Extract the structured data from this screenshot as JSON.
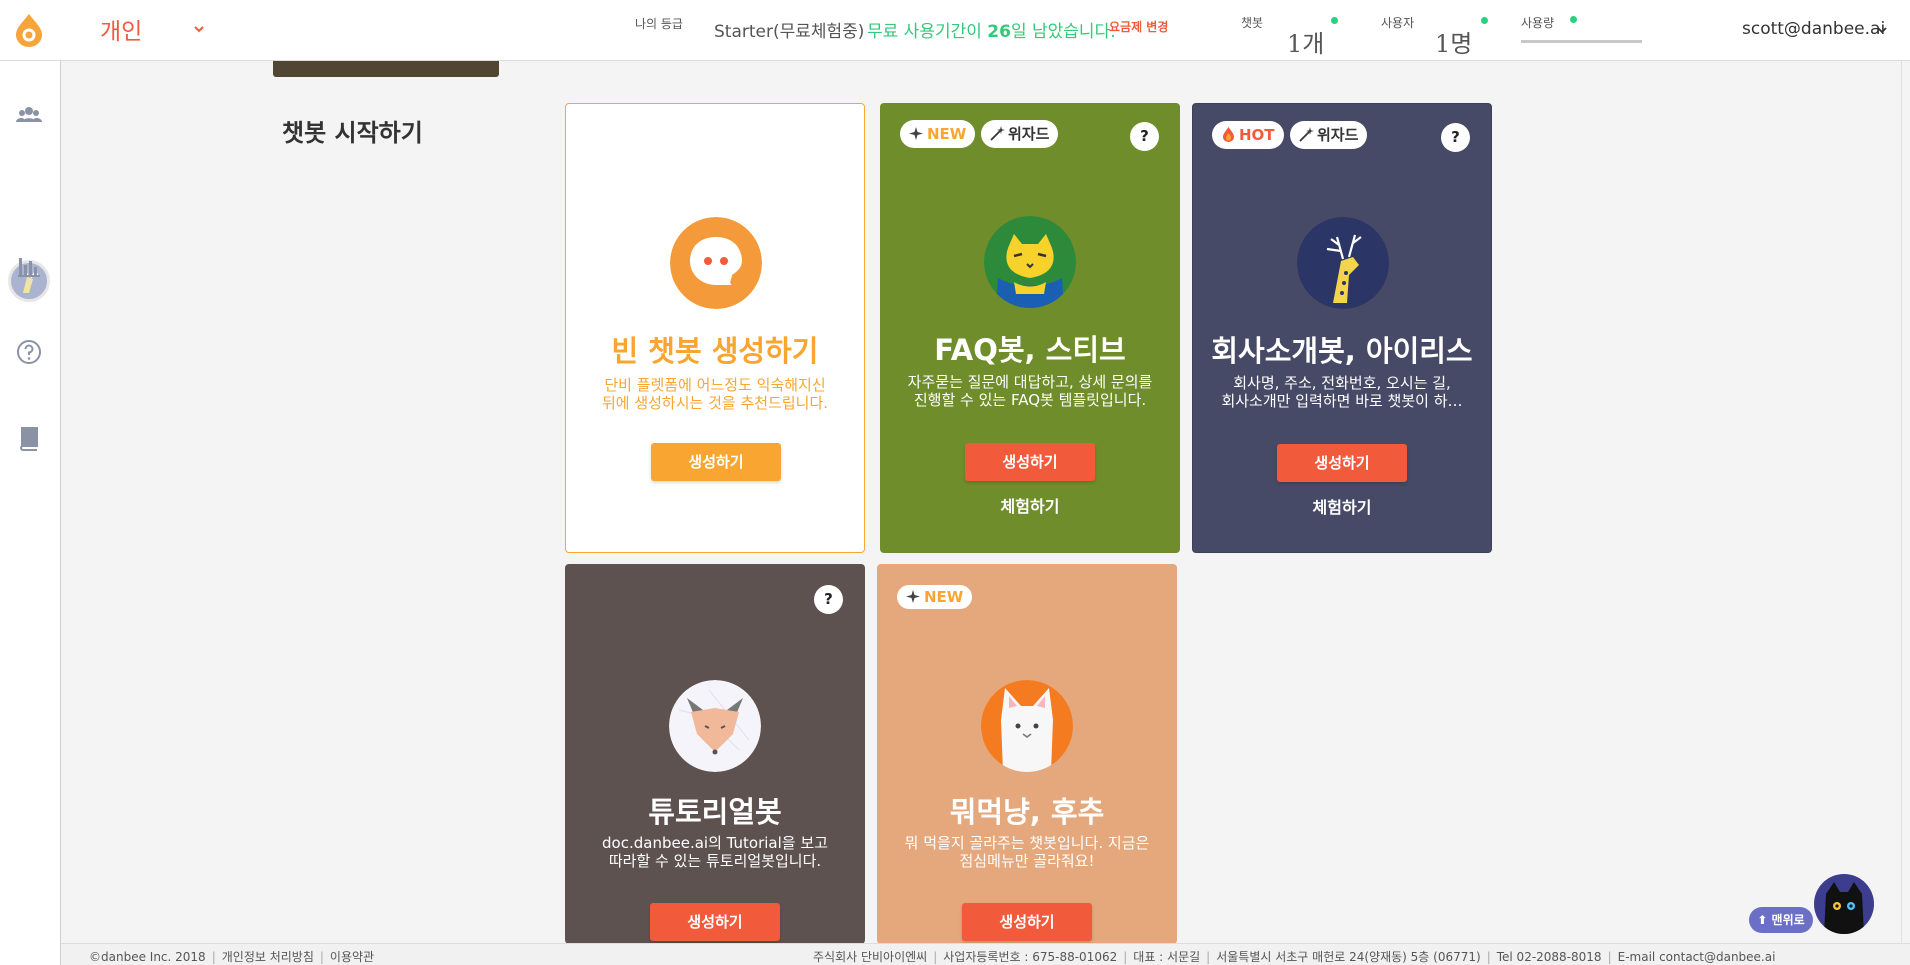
{
  "topbar": {
    "workspace": "개인",
    "grade_label": "나의 등급",
    "grade_value": "Starter(무료체험중)",
    "trial_prefix": "무료 사용기간이 ",
    "trial_days": "26",
    "trial_suffix": "일 남았습니다.",
    "plan_change": "요금제 변경",
    "chatbot_label": "챗봇",
    "chatbot_value": "1개",
    "users_label": "사용자",
    "users_value": "1명",
    "usage_label": "사용량",
    "user_email": "scott@danbee.ai",
    "status_color": "#27d17f",
    "accent_color": "#f25a3c"
  },
  "sidebar": {
    "items": [
      {
        "icon": "users-icon"
      },
      {
        "icon": "chatbot-avatar"
      },
      {
        "icon": "chart-icon"
      },
      {
        "icon": "help-icon"
      },
      {
        "icon": "book-icon"
      }
    ]
  },
  "main": {
    "section_title": "챗봇 시작하기",
    "cards": [
      {
        "title": "빈 챗봇 생성하기",
        "desc": "단비 플렛폼에 어느정도 익숙해지신\n뒤에 생성하시는 것을 추천드립니다.",
        "create": "생성하기",
        "bg": "#ffffff",
        "accent": "#f9a531"
      },
      {
        "title": "FAQ봇, 스티브",
        "desc": "자주묻는 질문에 대답하고, 상세 문의를\n진행할 수 있는 FAQ봇 템플릿입니다.",
        "create": "생성하기",
        "try": "체험하기",
        "tag1": "NEW",
        "tag2": "위자드",
        "help": "?",
        "bg": "#6f8d2a"
      },
      {
        "title": "회사소개봇, 아이리스",
        "desc": "회사명, 주소, 전화번호, 오시는 길,\n회사소개만 입력하면 바로 챗봇이 하…",
        "create": "생성하기",
        "try": "체험하기",
        "tag1": "HOT",
        "tag2": "위자드",
        "help": "?",
        "bg": "#474a66"
      },
      {
        "title": "튜토리얼봇",
        "desc": "doc.danbee.ai의 Tutorial을 보고\n따라할 수 있는 튜토리얼봇입니다.",
        "create": "생성하기",
        "help": "?",
        "bg": "#5e5250"
      },
      {
        "title": "뭐먹냥, 후추",
        "desc": "뭐 먹을지 골라주는 챗봇입니다. 지금은\n점심메뉴만 골라줘요!",
        "create": "생성하기",
        "tag1": "NEW",
        "bg": "#e4a87c"
      }
    ]
  },
  "footer": {
    "copyright": "©danbee Inc. 2018",
    "privacy": "개인정보 처리방침",
    "terms": "이용약관",
    "company": "주식회사 단비아이엔씨",
    "biz_no": "사업자등록번호 : 675-88-01062",
    "ceo": "대표 : 서문길",
    "address": "서울특별시 서초구 매헌로 24(양재동) 5층 (06771)",
    "tel": "Tel 02-2088-8018",
    "email": "E-mail contact@danbee.ai"
  },
  "floating": {
    "menu_label": "⬆ 맨위로"
  }
}
